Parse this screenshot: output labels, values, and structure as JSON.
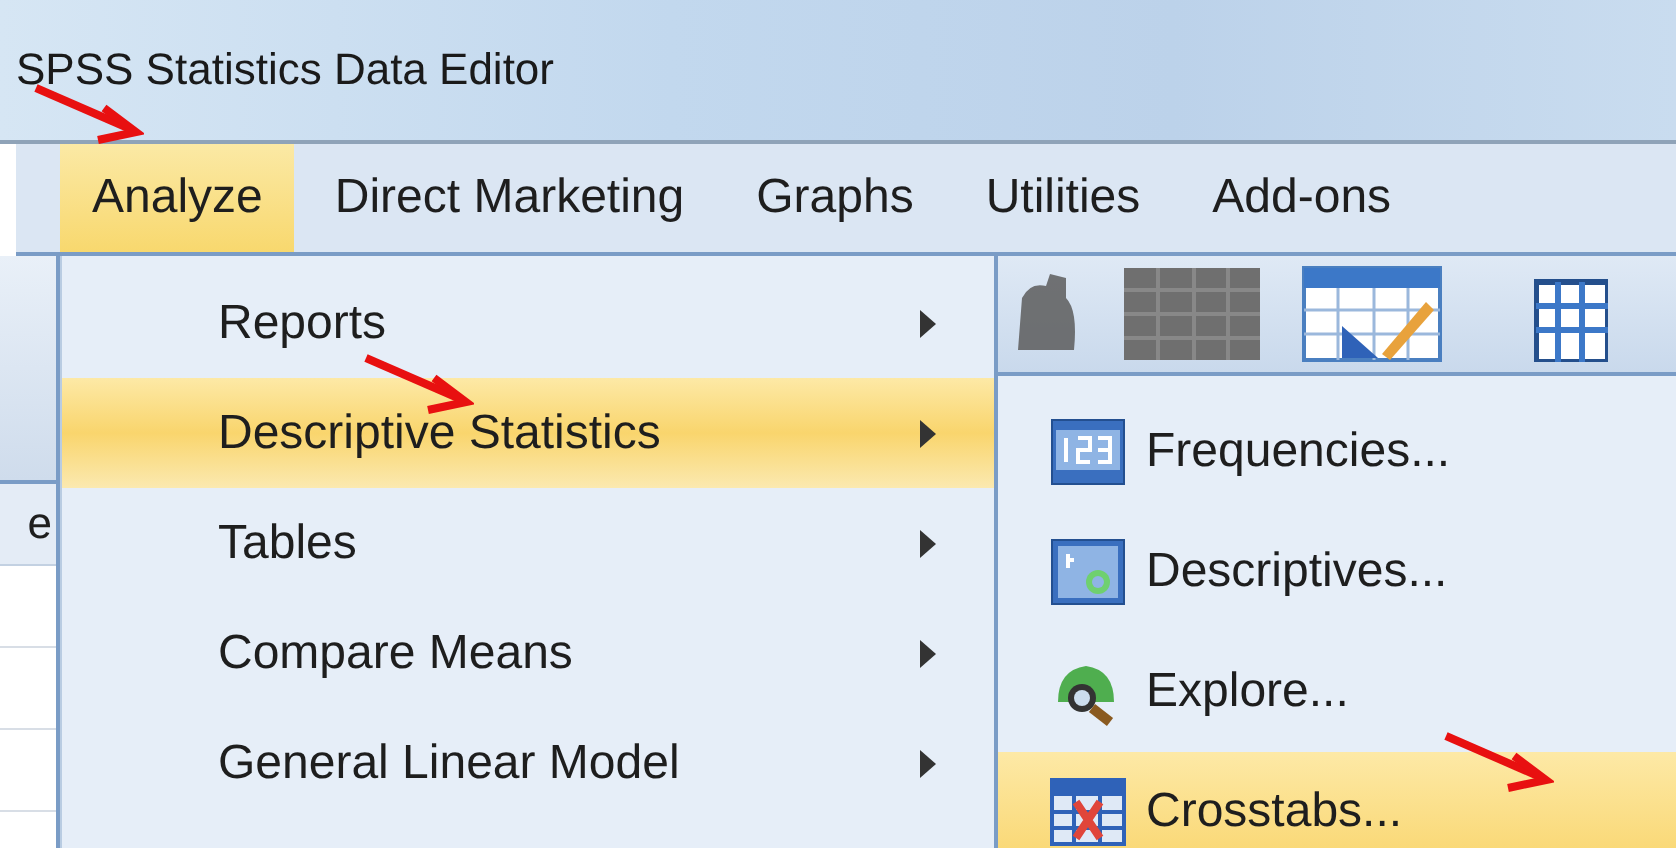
{
  "window": {
    "title": "SPSS Statistics Data Editor"
  },
  "menu_bar": [
    {
      "label": "Analyze",
      "selected": true,
      "annotated": true
    },
    {
      "label": "Direct Marketing",
      "selected": false,
      "annotated": false
    },
    {
      "label": "Graphs",
      "selected": false,
      "annotated": false
    },
    {
      "label": "Utilities",
      "selected": false,
      "annotated": false
    },
    {
      "label": "Add-ons",
      "selected": false,
      "annotated": false
    }
  ],
  "data_grid": {
    "column_header": "e"
  },
  "analyze_menu": [
    {
      "label": "Reports",
      "selected": false,
      "annotated": false
    },
    {
      "label": "Descriptive Statistics",
      "selected": true,
      "annotated": true
    },
    {
      "label": "Tables",
      "selected": false,
      "annotated": false
    },
    {
      "label": "Compare Means",
      "selected": false,
      "annotated": false
    },
    {
      "label": "General Linear Model",
      "selected": false,
      "annotated": false
    }
  ],
  "descriptive_statistics_menu": [
    {
      "label": "Frequencies...",
      "selected": false,
      "annotated": false
    },
    {
      "label": "Descriptives...",
      "selected": false,
      "annotated": false
    },
    {
      "label": "Explore...",
      "selected": false,
      "annotated": false
    },
    {
      "label": "Crosstabs...",
      "selected": true,
      "annotated": true
    }
  ]
}
